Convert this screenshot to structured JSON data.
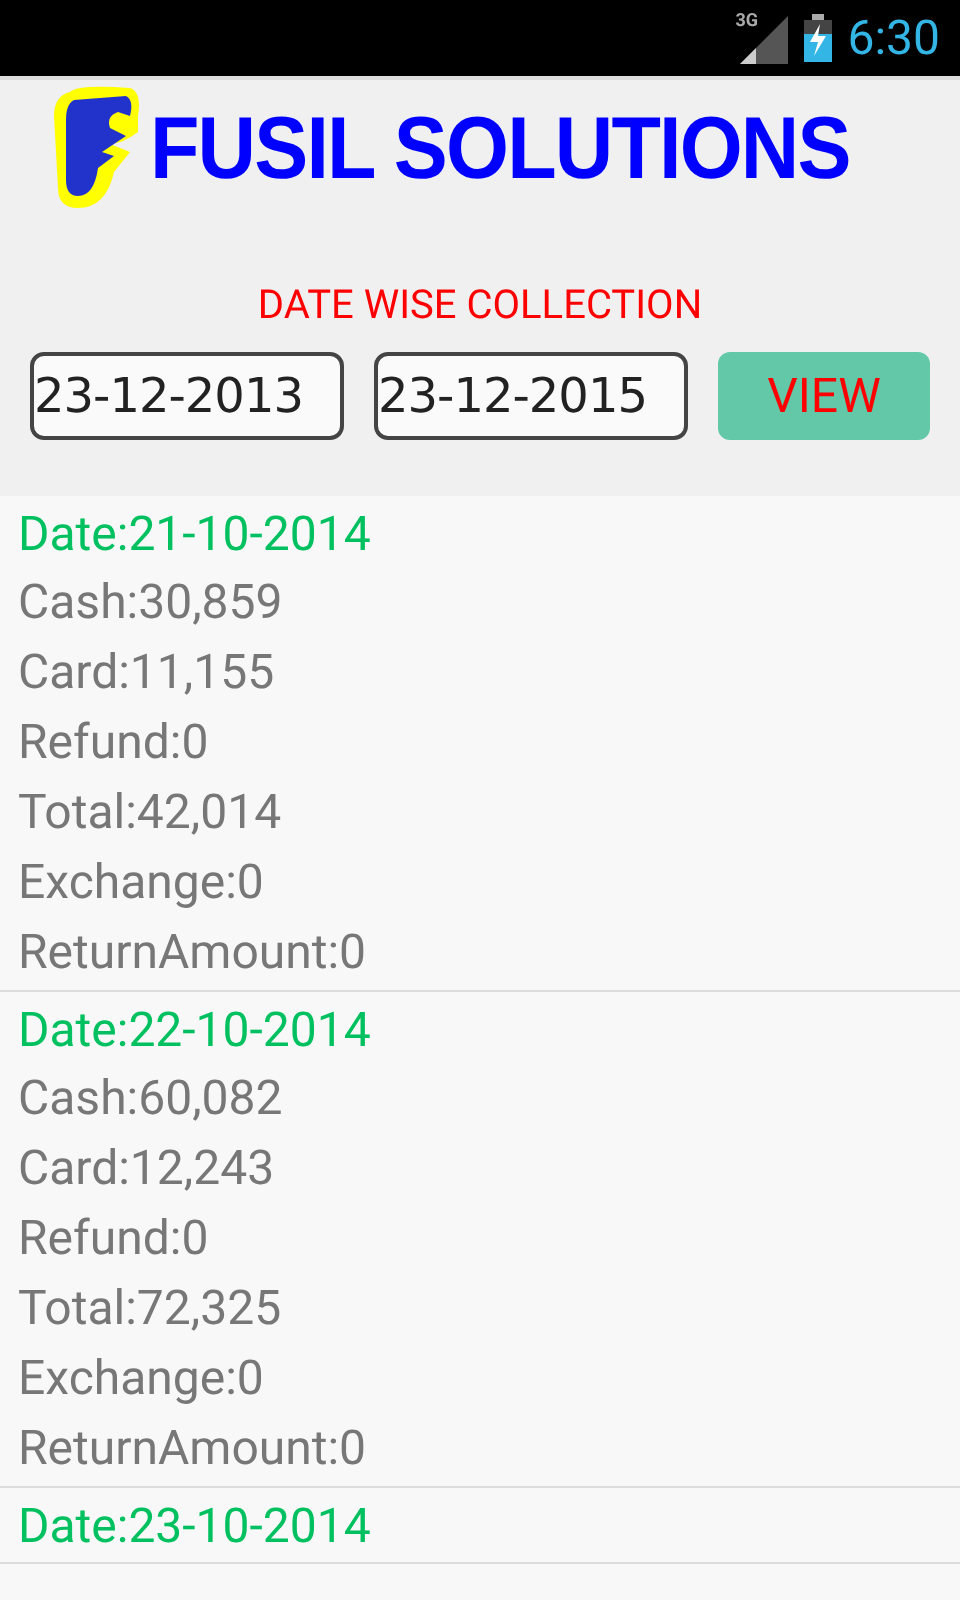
{
  "status_bar": {
    "network": "3G",
    "time": "6:30"
  },
  "header": {
    "brand": "FUSIL SOLUTIONS",
    "subtitle": "DATE WISE COLLECTION",
    "from_date": "23-12-2013",
    "to_date": "23-12-2015",
    "button": "VIEW"
  },
  "collections": [
    {
      "date": "Date:21-10-2014",
      "lines": [
        "Cash:30,859",
        "Card:11,155",
        "Refund:0",
        "Total:42,014",
        "Exchange:0",
        "ReturnAmount:0"
      ]
    },
    {
      "date": "Date:22-10-2014",
      "lines": [
        "Cash:60,082",
        "Card:12,243",
        "Refund:0",
        "Total:72,325",
        "Exchange:0",
        "ReturnAmount:0"
      ]
    },
    {
      "date": "Date:23-10-2014"
    }
  ]
}
